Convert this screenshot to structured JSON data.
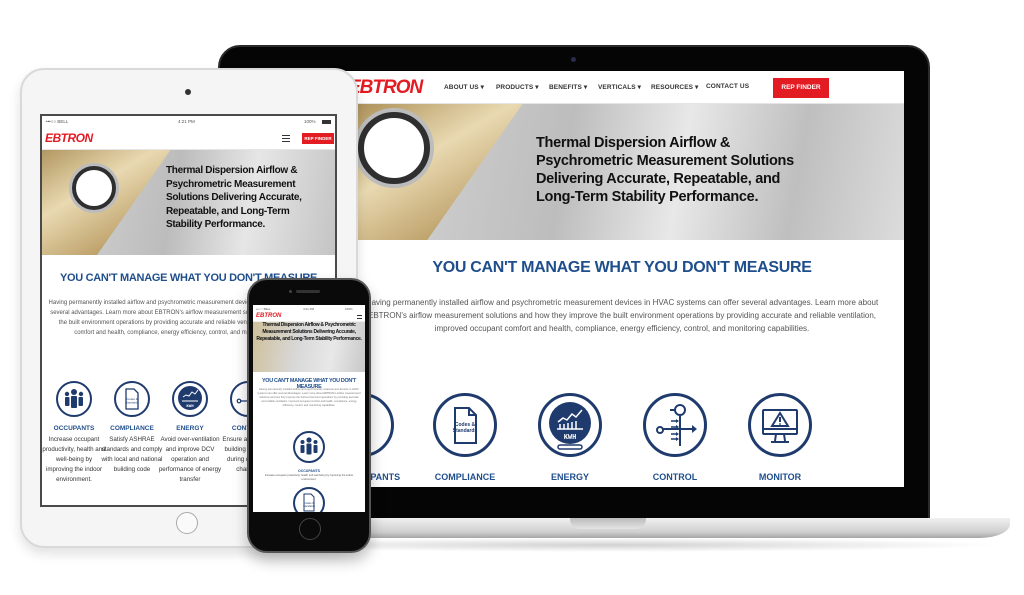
{
  "site": {
    "brand": "EBTRON",
    "colors": {
      "brand_red": "#e31b23",
      "heading_blue": "#1f4e8c",
      "icon_navy": "#1f3b6e"
    },
    "nav": {
      "items": [
        {
          "label": "ABOUT US",
          "has_dropdown": true
        },
        {
          "label": "PRODUCTS",
          "has_dropdown": true
        },
        {
          "label": "BENEFITS",
          "has_dropdown": true
        },
        {
          "label": "VERTICALS",
          "has_dropdown": true
        },
        {
          "label": "RESOURCES",
          "has_dropdown": true
        },
        {
          "label": "CONTACT US",
          "has_dropdown": false
        }
      ],
      "dropdown_glyph": "▾",
      "rep_finder": "REP FINDER"
    },
    "hero": {
      "title": "Thermal Dispersion Airflow & Psychrometric Measurement Solutions Delivering Accurate, Repeatable, and Long-Term Stability Performance."
    },
    "section": {
      "heading": "YOU CAN'T MANAGE WHAT YOU DON'T MEASURE",
      "paragraph": "Having permanently installed airflow and psychrometric measurement devices in HVAC systems can offer several advantages. Learn more about EBTRON's airflow measurement solutions and how they improve the built environment operations by providing accurate and reliable ventilation, improved occupant comfort and health, compliance, energy efficiency, control, and monitoring capabilities."
    },
    "benefits": [
      {
        "label": "OCCUPANTS",
        "icon": "occupants-icon",
        "description": "Increase occupant productivity, health and well-being by improving the indoor environment."
      },
      {
        "label": "COMPLIANCE",
        "icon": "codes-standards-icon",
        "icon_text": "Codes & Standards",
        "description": "Satisfy ASHRAE standards and comply with local and national building code"
      },
      {
        "label": "ENERGY",
        "icon": "energy-meter-icon",
        "icon_text": "KWH",
        "description": "Avoid over-ventilation and improve DCV operation and performance of energy transfer"
      },
      {
        "label": "CONTROL",
        "icon": "control-icon",
        "description": "Ensure air dilution, building pressure during dynamic changes"
      },
      {
        "label": "MONITOR",
        "icon": "monitor-alert-icon",
        "description": ""
      }
    ]
  },
  "devices": {
    "status_bar": {
      "carrier": "•••○○ BELL",
      "wifi": "wifi-icon",
      "time": "4:21 PM",
      "battery": "100%"
    },
    "menu_icon": "hamburger-menu-icon"
  }
}
